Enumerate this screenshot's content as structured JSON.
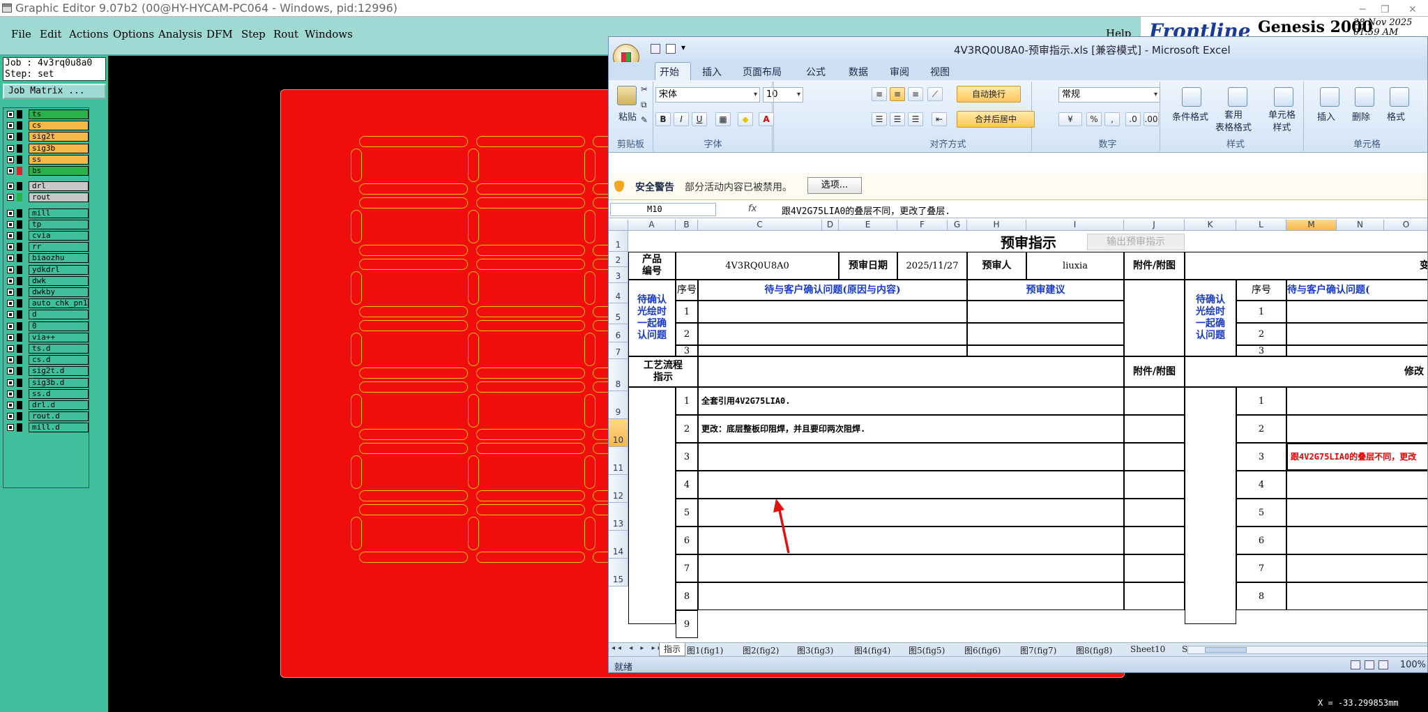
{
  "ge": {
    "title": "Graphic Editor 9.07b2 (00@HY-HYCAM-PC064 - Windows, pid:12996)",
    "menu": [
      "File",
      "Edit",
      "Actions",
      "Options",
      "Analysis",
      "DFM",
      "Step",
      "Rout",
      "Windows"
    ],
    "help": "Help",
    "brand": "Frontline",
    "product": "Genesis 2000",
    "date": "28 Nov 2025\n01:59 AM",
    "job_line": "Job : 4v3rq0u8a0",
    "step_line": "Step: set",
    "job_matrix": "Job Matrix ...",
    "layers": [
      {
        "name": "ts",
        "color": "#27b24a",
        "box": "#000000"
      },
      {
        "name": "cs",
        "color": "#f5b94a",
        "box": "#000000"
      },
      {
        "name": "sig2t",
        "color": "#f5b94a",
        "box": "#000000"
      },
      {
        "name": "sig3b",
        "color": "#f5b94a",
        "box": "#000000"
      },
      {
        "name": "ss",
        "color": "#f5b94a",
        "box": "#000000"
      },
      {
        "name": "bs",
        "color": "#27b24a",
        "box": "#e0202a"
      },
      {
        "name": "drl",
        "color": "#c8c8c8",
        "box": "#000000"
      },
      {
        "name": "rout",
        "color": "#c8c8c8",
        "box": "#27b24a"
      },
      {
        "name": "mill",
        "color": "#3fbf9c",
        "box": "#000000"
      },
      {
        "name": "tp",
        "color": "#3fbf9c",
        "box": "#000000"
      },
      {
        "name": "cvia",
        "color": "#3fbf9c",
        "box": "#000000"
      },
      {
        "name": "rr",
        "color": "#3fbf9c",
        "box": "#000000"
      },
      {
        "name": "biaozhu",
        "color": "#3fbf9c",
        "box": "#000000"
      },
      {
        "name": "ydkdrl",
        "color": "#3fbf9c",
        "box": "#000000"
      },
      {
        "name": "dwk",
        "color": "#3fbf9c",
        "box": "#000000"
      },
      {
        "name": "dwkby",
        "color": "#3fbf9c",
        "box": "#000000"
      },
      {
        "name": "auto_chk_pn1",
        "color": "#3fbf9c",
        "box": "#000000"
      },
      {
        "name": "d",
        "color": "#3fbf9c",
        "box": "#000000"
      },
      {
        "name": "0",
        "color": "#3fbf9c",
        "box": "#000000"
      },
      {
        "name": "via++",
        "color": "#3fbf9c",
        "box": "#000000"
      },
      {
        "name": "ts.d",
        "color": "#3fbf9c",
        "box": "#000000"
      },
      {
        "name": "cs.d",
        "color": "#3fbf9c",
        "box": "#000000"
      },
      {
        "name": "sig2t.d",
        "color": "#3fbf9c",
        "box": "#000000"
      },
      {
        "name": "sig3b.d",
        "color": "#3fbf9c",
        "box": "#000000"
      },
      {
        "name": "ss.d",
        "color": "#3fbf9c",
        "box": "#000000"
      },
      {
        "name": "drl.d",
        "color": "#3fbf9c",
        "box": "#000000"
      },
      {
        "name": "rout.d",
        "color": "#3fbf9c",
        "box": "#000000"
      },
      {
        "name": "mill.d",
        "color": "#3fbf9c",
        "box": "#000000"
      }
    ],
    "coord": "X = -33.299853mm"
  },
  "excel": {
    "title": "4V3RQ0U8A0-预审指示.xls  [兼容模式] - Microsoft Excel",
    "tabs": [
      "开始",
      "插入",
      "页面布局",
      "公式",
      "数据",
      "审阅",
      "视图"
    ],
    "ribbon": {
      "paste": "粘贴",
      "clipboard": "剪贴板",
      "font_name": "宋体",
      "font_size": "10",
      "font_group": "字体",
      "wrap": "自动换行",
      "merge": "合并后居中",
      "align_group": "对齐方式",
      "numfmt": "常规",
      "number_group": "数字",
      "cond": "条件格式",
      "table": "套用\n表格格式",
      "cellstyle": "单元格\n样式",
      "style_group": "样式",
      "insert": "插入",
      "delete": "删除",
      "format": "格式",
      "cells_group": "单元格"
    },
    "security": {
      "label": "安全警告",
      "msg": "部分活动内容已被禁用。",
      "btn": "选项..."
    },
    "namebox": "M10",
    "formula": "跟4V2G75LIA0的叠层不同，更改了叠层.",
    "columns": [
      "A",
      "B",
      "C",
      "D",
      "E",
      "F",
      "G",
      "H",
      "I",
      "J",
      "K",
      "L",
      "M",
      "N",
      "O"
    ],
    "rows": [
      "1",
      "2",
      "3",
      "4",
      "5",
      "6",
      "7",
      "8",
      "9",
      "10",
      "11",
      "12",
      "13",
      "14",
      "15"
    ],
    "sheet": {
      "title": "预审指示",
      "exit_btn": "输出预审指示",
      "product_label": "产品\n编号",
      "product": "4V3RQ0U8A0",
      "date_label": "预审日期",
      "date": "2025/11/27",
      "reviewer_label": "预审人",
      "reviewer": "liuxia",
      "attach": "附件/附图",
      "seq": "序号",
      "pending": "待与客户确认问题(原因与内容)",
      "pending_r": "待与客户确认问题(",
      "advice": "预审建议",
      "group_label": "待确认\n光绘时\n一起确\n认问题",
      "process": "工艺流程\n指示",
      "modify": "修改",
      "trunc_r": "变",
      "seqs": [
        "1",
        "2",
        "3",
        "4",
        "5",
        "6",
        "7",
        "8",
        "9"
      ],
      "instructions": [
        "全套引用4V2G75LIA0.",
        "更改：底层整板印阻焊，并且要印两次阻焊.",
        "",
        "",
        "",
        "",
        "",
        ""
      ],
      "modify_r": [
        "",
        "",
        "跟4V2G75LIA0的叠层不同，更改",
        "",
        "",
        "",
        "",
        ""
      ]
    },
    "sheet_tabs": [
      "指示",
      "图1(fig1)",
      "图2(fig2)",
      "图3(fig3)",
      "图4(fig4)",
      "图5(fig5)",
      "图6(fig6)",
      "图7(fig7)",
      "图8(fig8)",
      "Sheet10",
      "S"
    ],
    "status": "就绪",
    "zoom": "100%"
  }
}
